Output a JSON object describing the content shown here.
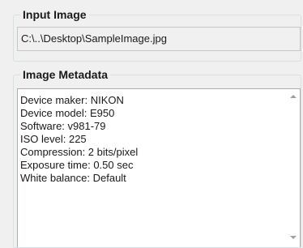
{
  "input_image": {
    "title": "Input Image",
    "path": "C:\\..\\Desktop\\SampleImage.jpg"
  },
  "image_metadata": {
    "title": "Image Metadata",
    "lines": [
      "Device maker: NIKON",
      "Device model: E950",
      "Software: v981-79",
      "ISO level: 225",
      "Compression: 2 bits/pixel",
      "Exposure time: 0.50 sec",
      "White balance: Default"
    ]
  },
  "icons": {
    "scroll_up": "chevron-up-icon",
    "scroll_down": "chevron-down-icon"
  }
}
